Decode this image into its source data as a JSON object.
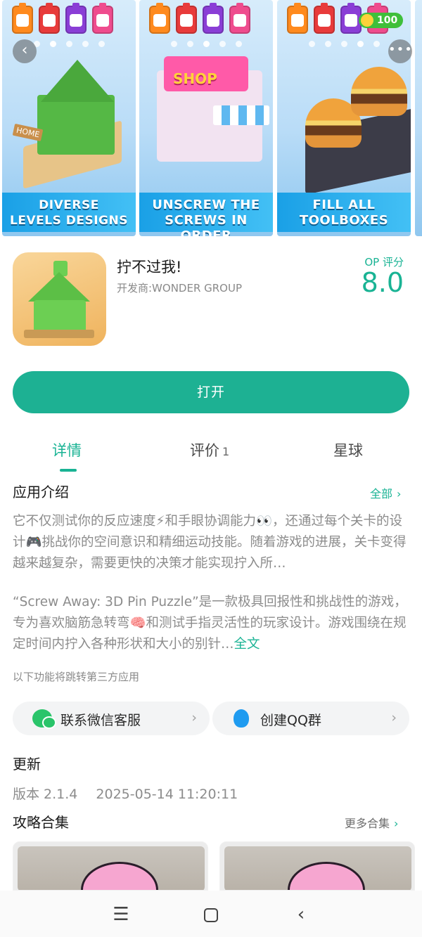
{
  "carousel": {
    "shots": [
      {
        "caption_line1": "DIVERSE",
        "caption_line2": "LEVELS DESIGNS"
      },
      {
        "caption_line1": "UNSCREW THE",
        "caption_line2": "SCREWS IN ORDER"
      },
      {
        "caption_line1": "FILL ALL",
        "caption_line2": "TOOLBOXES"
      }
    ],
    "shop_sign": "SHOP",
    "home_sign": "HOME",
    "coin_count": "100",
    "back_icon": "chevron-left-icon",
    "more_icon": "more-dots-icon"
  },
  "app": {
    "name": "拧不过我!",
    "developer": "开发商:WONDER GROUP",
    "rating_label": "OP 评分",
    "rating_value": "8.0",
    "accent_color": "#19b394"
  },
  "actions": {
    "open_label": "打开"
  },
  "tabs": [
    {
      "label": "详情"
    },
    {
      "label": "评价",
      "count": "1"
    },
    {
      "label": "星球"
    }
  ],
  "intro": {
    "title": "应用介绍",
    "all_label": "全部",
    "para1": "它不仅测试你的反应速度⚡和手眼协调能力👀，还通过每个关卡的设计🎮挑战你的空间意识和精细运动技能。随着游戏的进展，关卡变得越来越复杂，需要更快的决策才能实现拧入所…",
    "para2": "“Screw Away: 3D Pin Puzzle”是一款极具回报性和挑战性的游戏，专为喜欢脑筋急转弯🧠和测试手指灵活性的玩家设计。游戏围绕在规定时间内拧入各种形状和大小的别针…",
    "para2_more": "全文",
    "third_party_note": "以下功能将跳转第三方应用"
  },
  "links": [
    {
      "label": "联系微信客服",
      "icon": "wechat-icon"
    },
    {
      "label": "创建QQ群",
      "icon": "qq-icon"
    }
  ],
  "update": {
    "title": "更新",
    "version": "版本 2.1.4",
    "date": "2025-05-14 11:20:11"
  },
  "guides": {
    "title": "攻略合集",
    "more_label": "更多合集"
  },
  "nav": {
    "menu_icon": "menu-icon",
    "home_icon": "home-icon",
    "back_icon": "back-icon"
  }
}
